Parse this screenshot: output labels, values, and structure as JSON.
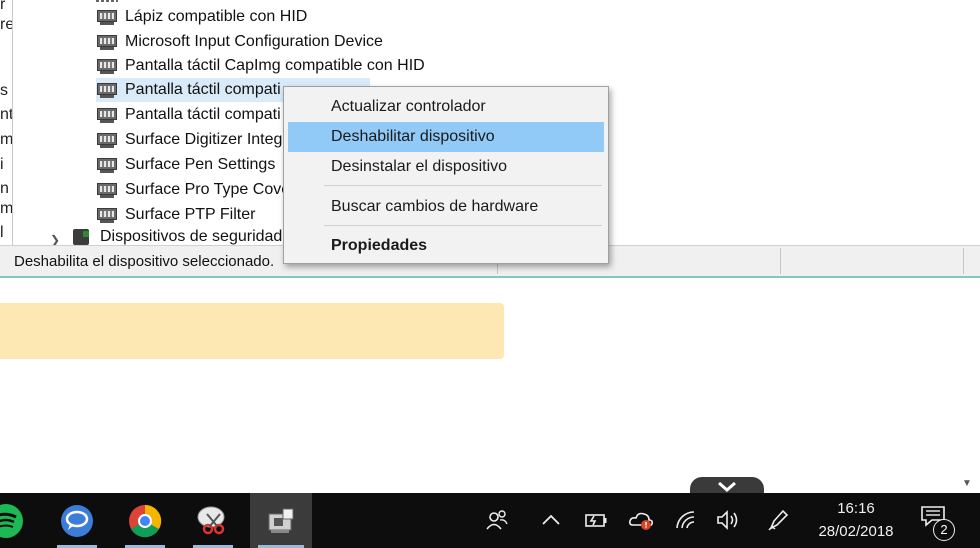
{
  "device_manager": {
    "left_edge_chars": [
      "r",
      "re",
      "",
      "s",
      "nt",
      "m",
      "i",
      "n",
      "m",
      "l"
    ],
    "items": [
      {
        "label": "Lápiz compatible con HID"
      },
      {
        "label": "Microsoft Input Configuration Device"
      },
      {
        "label": "Pantalla táctil CapImg compatible con HID"
      },
      {
        "label": "Pantalla táctil compati",
        "selected": true
      },
      {
        "label": "Pantalla táctil compati"
      },
      {
        "label": "Surface Digitizer Integ"
      },
      {
        "label": "Surface Pen Settings"
      },
      {
        "label": "Surface Pro Type Cove"
      },
      {
        "label": "Surface PTP Filter"
      }
    ],
    "category": {
      "label": "Dispositivos de seguridad"
    },
    "status_text": "Deshabilita el dispositivo seleccionado."
  },
  "context_menu": {
    "items": [
      {
        "label": "Actualizar controlador"
      },
      {
        "label": "Deshabilitar dispositivo",
        "highlighted": true
      },
      {
        "label": "Desinstalar el dispositivo"
      },
      {
        "label": "Buscar cambios de hardware"
      },
      {
        "label": "Propiedades",
        "bold": true
      }
    ]
  },
  "taskbar": {
    "apps": [
      {
        "name": "spotify-icon",
        "color": "#1db954"
      },
      {
        "name": "chat-app-icon",
        "color": "#3b7dd8"
      },
      {
        "name": "chrome-icon"
      },
      {
        "name": "snipping-tool-icon"
      },
      {
        "name": "device-manager-icon",
        "active": true
      }
    ],
    "tray": [
      "people-icon",
      "chevron-up-icon",
      "battery-icon",
      "onedrive-icon",
      "wifi-icon",
      "volume-icon",
      "pen-icon"
    ],
    "time": "16:16",
    "date": "28/02/2018",
    "notification_count": "2"
  },
  "colors": {
    "menu_highlight": "#91c9f7",
    "selected_row": "#d9ebf9",
    "banner": "#fde8b4",
    "taskbar": "#0d0d0d"
  }
}
